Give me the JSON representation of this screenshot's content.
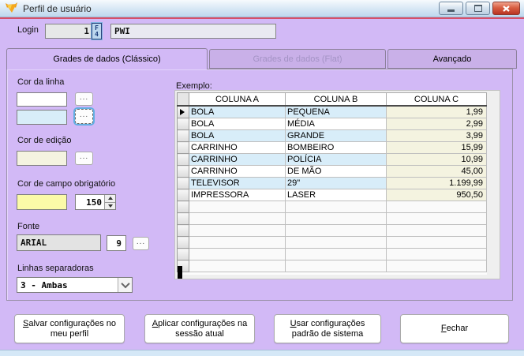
{
  "window": {
    "title": "Perfil de usuário"
  },
  "login": {
    "label": "Login",
    "code": "1",
    "lookup": [
      "F",
      "4"
    ],
    "name": "PWI"
  },
  "tabs": [
    {
      "label": "Grades de dados (Clássico)"
    },
    {
      "label": "Grades de dados (Flat)"
    },
    {
      "label": "Avançado"
    }
  ],
  "panel": {
    "line_color_label": "Cor da linha",
    "browse": "...",
    "edit_color_label": "Cor de edição",
    "required_color_label": "Cor de campo obrigatório",
    "required_value": "150",
    "font_label": "Fonte",
    "font_name": "ARIAL",
    "font_size": "9",
    "separators_label": "Linhas separadoras",
    "separators_value": "3 - Ambas",
    "colors": {
      "row_white": "#FFFFFF",
      "row_blue": "#D8EDF9",
      "edit": "#F4F3E0",
      "required": "#FBFAA8"
    }
  },
  "example": {
    "label": "Exemplo:",
    "table": {
      "columns": [
        "COLUNA A",
        "COLUNA B",
        "COLUNA C"
      ],
      "rows": [
        [
          "BOLA",
          "PEQUENA",
          "1,99"
        ],
        [
          "BOLA",
          "MÉDIA",
          "2,99"
        ],
        [
          "BOLA",
          "GRANDE",
          "3,99"
        ],
        [
          "CARRINHO",
          "BOMBEIRO",
          "15,99"
        ],
        [
          "CARRINHO",
          "POLÍCIA",
          "10,99"
        ],
        [
          "CARRINHO",
          "DE MÃO",
          "45,00"
        ],
        [
          "TELEVISOR",
          "29\"",
          "1.199,99"
        ],
        [
          "IMPRESSORA",
          "LASER",
          "950,50"
        ]
      ],
      "empty_rows": 6,
      "selected_row_index": 0
    }
  },
  "footer_buttons": [
    {
      "accel": "S",
      "rest": "alvar configurações no meu perfil"
    },
    {
      "accel": "A",
      "rest": "plicar configurações na sessão atual"
    },
    {
      "accel": "U",
      "rest": "sar configurações padrão de sistema"
    },
    {
      "accel": "F",
      "rest": "echar"
    }
  ]
}
